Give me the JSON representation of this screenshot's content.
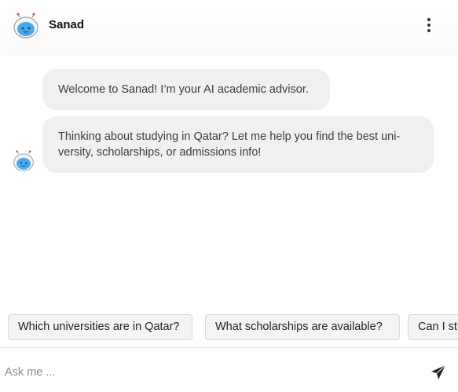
{
  "header": {
    "title": "Sanad",
    "avatar_icon": "robot-mascot-icon",
    "menu_icon": "more-vertical-icon"
  },
  "messages": [
    {
      "sender": "bot",
      "text": "Welcome to Sanad! I’m your AI academic advisor."
    },
    {
      "sender": "bot",
      "text": "Thinking about studying in Qatar? Let me help you find the best uni-versity, scholarships, or admissions info!"
    }
  ],
  "suggestions": [
    "Which universities are in Qatar?",
    "What scholarships are available?",
    "Can I stu"
  ],
  "input": {
    "placeholder": "Ask me ...",
    "value": ""
  },
  "send_icon": "paper-plane-icon",
  "colors": {
    "bubble_bg": "#f0f0f2",
    "chip_bg": "#f4f4f5",
    "mascot_blue": "#4aa8ec"
  }
}
